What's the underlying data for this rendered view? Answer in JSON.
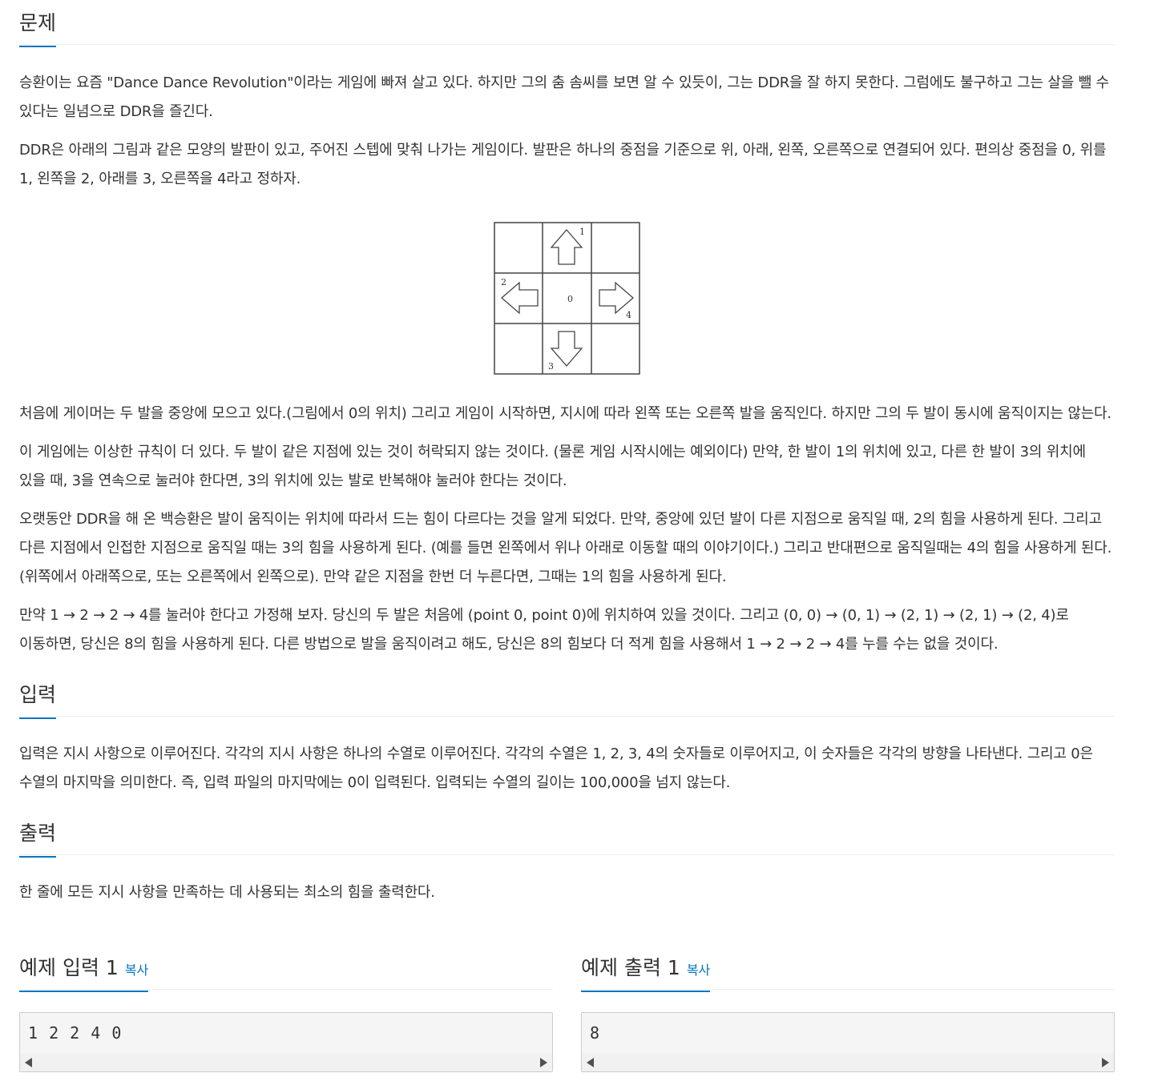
{
  "problem": {
    "heading": "문제",
    "paragraphs": [
      "승환이는 요즘 \"Dance Dance Revolution\"이라는 게임에 빠져 살고 있다. 하지만 그의 춤 솜씨를 보면 알 수 있듯이, 그는 DDR을 잘 하지 못한다. 그럼에도 불구하고 그는 살을 뺄 수 있다는 일념으로 DDR을 즐긴다.",
      "DDR은 아래의 그림과 같은 모양의 발판이 있고, 주어진 스텝에 맞춰 나가는 게임이다. 발판은 하나의 중점을 기준으로 위, 아래, 왼쪽, 오른쪽으로 연결되어 있다. 편의상 중점을 0, 위를 1, 왼쪽을 2, 아래를 3, 오른쪽을 4라고 정하자."
    ],
    "figure_labels": {
      "center": "0",
      "up": "1",
      "left": "2",
      "down": "3",
      "right": "4"
    },
    "paragraphs_after": [
      "처음에 게이머는 두 발을 중앙에 모으고 있다.(그림에서 0의 위치) 그리고 게임이 시작하면, 지시에 따라 왼쪽 또는 오른쪽 발을 움직인다. 하지만 그의 두 발이 동시에 움직이지는 않는다.",
      "이 게임에는 이상한 규칙이 더 있다. 두 발이 같은 지점에 있는 것이 허락되지 않는 것이다. (물론 게임 시작시에는 예외이다) 만약, 한 발이 1의 위치에 있고, 다른 한 발이 3의 위치에 있을 때, 3을 연속으로 눌러야 한다면, 3의 위치에 있는 발로 반복해야 눌러야 한다는 것이다.",
      "오랫동안 DDR을 해 온 백승환은 발이 움직이는 위치에 따라서 드는 힘이 다르다는 것을 알게 되었다. 만약, 중앙에 있던 발이 다른 지점으로 움직일 때, 2의 힘을 사용하게 된다. 그리고 다른 지점에서 인접한 지점으로 움직일 때는 3의 힘을 사용하게 된다. (예를 들면 왼쪽에서 위나 아래로 이동할 때의 이야기이다.) 그리고 반대편으로 움직일때는 4의 힘을 사용하게 된다. (위쪽에서 아래쪽으로, 또는 오른쪽에서 왼쪽으로). 만약 같은 지점을 한번 더 누른다면, 그때는 1의 힘을 사용하게 된다.",
      "만약 1 → 2 → 2 → 4를 눌러야 한다고 가정해 보자. 당신의 두 발은 처음에 (point 0, point 0)에 위치하여 있을 것이다. 그리고 (0, 0) → (0, 1) → (2, 1) → (2, 1) → (2, 4)로 이동하면, 당신은 8의 힘을 사용하게 된다. 다른 방법으로 발을 움직이려고 해도, 당신은 8의 힘보다 더 적게 힘을 사용해서 1 → 2 → 2 → 4를 누를 수는 없을 것이다."
    ]
  },
  "input": {
    "heading": "입력",
    "paragraph": "입력은 지시 사항으로 이루어진다. 각각의 지시 사항은 하나의 수열로 이루어진다. 각각의 수열은 1, 2, 3, 4의 숫자들로 이루어지고, 이 숫자들은 각각의 방향을 나타낸다. 그리고 0은 수열의 마지막을 의미한다. 즉, 입력 파일의 마지막에는 0이 입력된다. 입력되는 수열의 길이는 100,000을 넘지 않는다."
  },
  "output": {
    "heading": "출력",
    "paragraph": "한 줄에 모든 지시 사항을 만족하는 데 사용되는 최소의 힘을 출력한다."
  },
  "sample_input": {
    "heading": "예제 입력 1",
    "copy_label": "복사",
    "content": "1 2 2 4 0"
  },
  "sample_output": {
    "heading": "예제 출력 1",
    "copy_label": "복사",
    "content": "8"
  },
  "colors": {
    "accent": "#0076c0",
    "text": "#333333",
    "pre_bg": "#f5f5f5"
  }
}
